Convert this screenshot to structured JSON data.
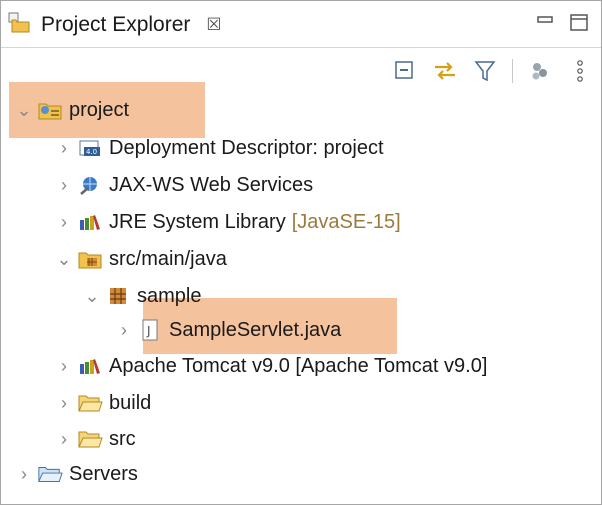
{
  "view": {
    "title": "Project Explorer",
    "close_glyph": "☒",
    "minimize_icon": "minimize-icon",
    "maximize_icon": "maximize-icon"
  },
  "toolbar": {
    "buttons": [
      "collapse-all-icon",
      "link-with-editor-icon",
      "filter-icon",
      "focus-on-working-set-icon",
      "view-menu-icon"
    ]
  },
  "tree": [
    {
      "label": "project",
      "decor": "",
      "expanded": true,
      "icon": "web-project-icon"
    },
    {
      "label": "Deployment Descriptor: project",
      "decor": "",
      "expanded": false,
      "icon": "deployment-descriptor-icon"
    },
    {
      "label": "JAX-WS Web Services",
      "decor": "",
      "expanded": false,
      "icon": "web-services-icon"
    },
    {
      "label": "JRE System Library",
      "decor": "[JavaSE-15]",
      "expanded": false,
      "icon": "library-icon"
    },
    {
      "label": "src/main/java",
      "decor": "",
      "expanded": true,
      "icon": "source-folder-icon"
    },
    {
      "label": "sample",
      "decor": "",
      "expanded": true,
      "icon": "package-icon"
    },
    {
      "label": "SampleServlet.java",
      "decor": "",
      "expanded": false,
      "icon": "java-file-icon"
    },
    {
      "label": "Apache Tomcat v9.0 [Apache Tomcat v9.0]",
      "decor": "",
      "expanded": false,
      "icon": "library-icon"
    },
    {
      "label": "build",
      "decor": "",
      "expanded": false,
      "icon": "folder-icon"
    },
    {
      "label": "src",
      "decor": "",
      "expanded": false,
      "icon": "folder-icon"
    },
    {
      "label": "Servers",
      "decor": "",
      "expanded": false,
      "icon": "project-folder-icon"
    }
  ],
  "colors": {
    "highlight": "#f5c29e",
    "decoration": "#9b7a3c",
    "chevron": "#888888"
  }
}
